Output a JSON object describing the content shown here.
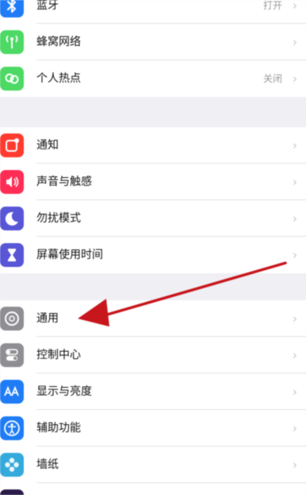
{
  "groups": [
    {
      "items": [
        {
          "label": "蓝牙",
          "value": "打开",
          "icon": "bluetooth-icon",
          "color": "#1f7cf6"
        },
        {
          "label": "蜂窝网络",
          "value": "",
          "icon": "cellular-antenna-icon",
          "color": "#4cd964"
        },
        {
          "label": "个人热点",
          "value": "关闭",
          "icon": "personal-hotspot-icon",
          "color": "#4cd964"
        }
      ]
    },
    {
      "items": [
        {
          "label": "通知",
          "value": "",
          "icon": "notifications-icon",
          "color": "#ff3b30"
        },
        {
          "label": "声音与触感",
          "value": "",
          "icon": "sound-speaker-icon",
          "color": "#ff2d55"
        },
        {
          "label": "勿扰模式",
          "value": "",
          "icon": "moon-icon",
          "color": "#5856d6"
        },
        {
          "label": "屏幕使用时间",
          "value": "",
          "icon": "hourglass-icon",
          "color": "#5856d6"
        }
      ]
    },
    {
      "items": [
        {
          "label": "通用",
          "value": "",
          "icon": "gear-icon",
          "color": "#8e8e93"
        },
        {
          "label": "控制中心",
          "value": "",
          "icon": "toggle-switches-icon",
          "color": "#8e8e93"
        },
        {
          "label": "显示与亮度",
          "value": "",
          "icon": "text-size-aa-icon",
          "color": "#1f7cf6"
        },
        {
          "label": "辅助功能",
          "value": "",
          "icon": "accessibility-icon",
          "color": "#1f7cf6"
        },
        {
          "label": "墙纸",
          "value": "",
          "icon": "wallpaper-flower-icon",
          "color": "#34aadc"
        }
      ]
    }
  ],
  "annotation": {
    "arrow_color": "#c8161d",
    "arrow_icon": "red-arrow-annotation"
  },
  "colors": {
    "background": "#efeff4",
    "cell": "#ffffff",
    "separator": "#e2e2e6",
    "value_text": "#9a9a9f"
  }
}
